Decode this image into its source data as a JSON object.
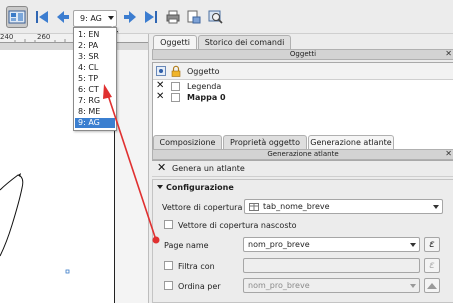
{
  "toolbar": {
    "atlas_page_value": "9: AG",
    "buttons": [
      "atlas-preview-icon",
      "first-feature-icon",
      "prev-feature-icon",
      "next-feature-icon",
      "last-feature-icon",
      "print-icon",
      "export-icon",
      "settings-icon"
    ]
  },
  "ruler": {
    "mark_1": "240",
    "mark_2": "260"
  },
  "dropdown": {
    "items": [
      "1: EN",
      "2: PA",
      "3: SR",
      "4: CL",
      "5: TP",
      "6: CT",
      "7: RG",
      "8: ME",
      "9: AG"
    ],
    "selected_index": 8
  },
  "panel": {
    "top_tabs": [
      "Oggetti",
      "Storico dei comandi"
    ],
    "objects_title": "Oggetti",
    "objects_header": "Oggetto",
    "objects": [
      "Legenda",
      "Mappa 0"
    ],
    "bottom_tabs": [
      "Composizione",
      "Proprietà oggetto",
      "Generazione atlante"
    ],
    "atlas_title": "Generazione atlante",
    "generate_label": "Genera un atlante",
    "config_label": "Configurazione",
    "coverage_label": "Vettore di copertura",
    "coverage_value": "tab_nome_breve",
    "hidden_label": "Vettore di copertura nascosto",
    "page_name_label": "Page name",
    "page_name_value": "nom_pro_breve",
    "filter_label": "Filtra con",
    "sort_label": "Ordina per",
    "sort_value": "nom_pro_breve",
    "expression_symbol": "ε"
  },
  "colors": {
    "selection": "#3b7fd0",
    "annotation": "#e03030"
  }
}
